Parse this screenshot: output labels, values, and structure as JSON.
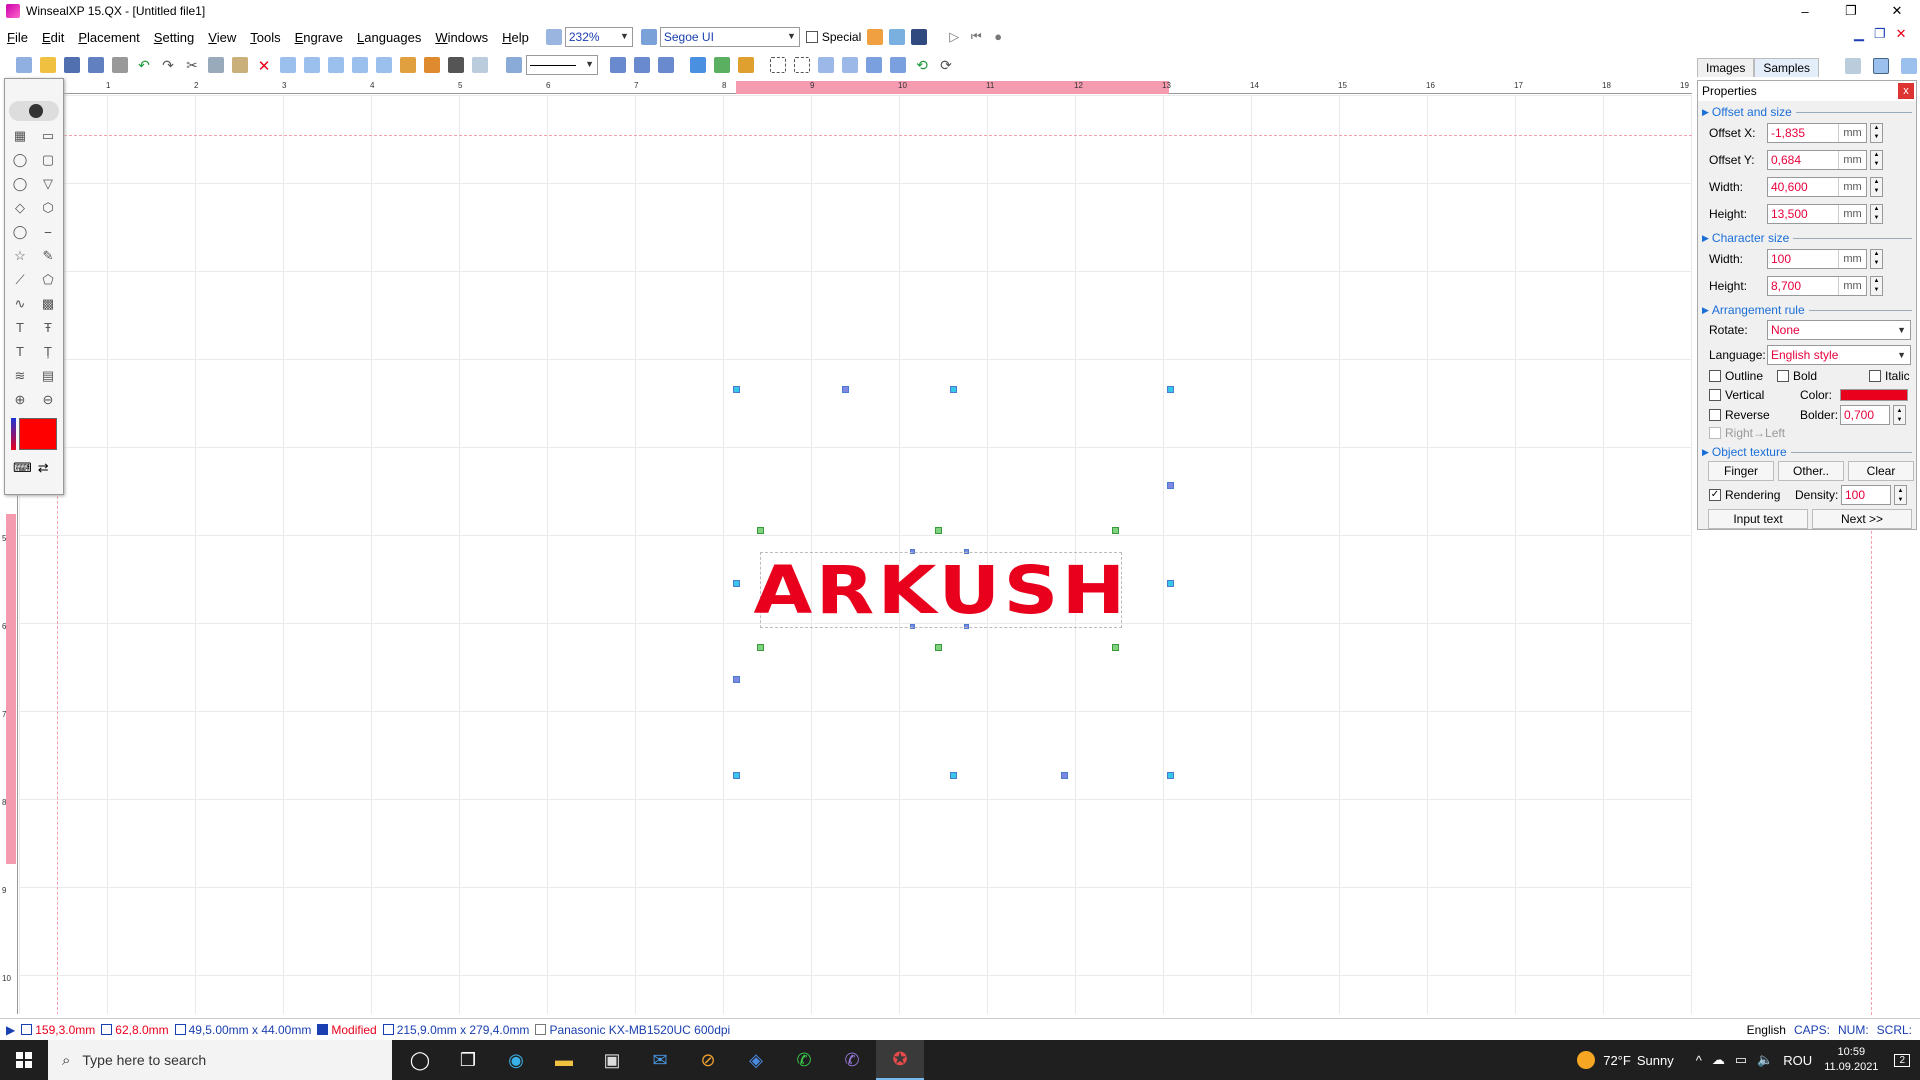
{
  "window": {
    "title": "WinsealXP 15.QX - [Untitled file1]",
    "min": "–",
    "max": "❐",
    "close": "✕"
  },
  "menu": [
    "File",
    "Edit",
    "Placement",
    "Setting",
    "View",
    "Tools",
    "Engrave",
    "Languages",
    "Windows",
    "Help"
  ],
  "toolbar": {
    "zoom": "232%",
    "font": "Segoe UI",
    "special_label": "Special"
  },
  "right_tabs": [
    "Images",
    "Samples"
  ],
  "ruler_h_labels": [
    "1",
    "2",
    "3",
    "4",
    "5",
    "6",
    "7",
    "8",
    "9",
    "10",
    "11",
    "12",
    "13",
    "14",
    "15",
    "16",
    "17",
    "18",
    "19"
  ],
  "ruler_v_labels": [
    "5",
    "6",
    "7",
    "8",
    "9",
    "10"
  ],
  "canvas_text": "ARKUSH",
  "properties": {
    "title": "Properties",
    "close": "x",
    "sec_offset": "Offset and size",
    "offset_x_label": "Offset X:",
    "offset_x": "-1,835",
    "offset_y_label": "Offset Y:",
    "offset_y": "0,684",
    "width_label": "Width:",
    "width": "40,600",
    "height_label": "Height:",
    "height": "13,500",
    "unit": "mm",
    "sec_char": "Character size",
    "char_width_label": "Width:",
    "char_width": "100",
    "char_height_label": "Height:",
    "char_height": "8,700",
    "sec_arrange": "Arrangement rule",
    "rotate_label": "Rotate:",
    "rotate": "None",
    "language_label": "Language:",
    "language": "English style",
    "outline": "Outline",
    "bold": "Bold",
    "italic": "Italic",
    "vertical": "Vertical",
    "color_label": "Color:",
    "reverse": "Reverse",
    "bolder_label": "Bolder:",
    "bolder": "0,700",
    "right_left": "Right→Left",
    "sec_texture": "Object texture",
    "finger": "Finger",
    "other": "Other..",
    "clear": "Clear",
    "rendering": "Rendering",
    "density_label": "Density:",
    "density": "100",
    "input_text": "Input text",
    "next": "Next >>"
  },
  "status": {
    "pos_x": "159,3.0mm",
    "pos_y": "62,8.0mm",
    "size": "49,5.00mm x 44.00mm",
    "modified": "Modified",
    "paper": "215,9.0mm x 279,4.0mm",
    "printer": "Panasonic KX-MB1520UC 600dpi",
    "lang": "English",
    "caps": "CAPS:",
    "num": "NUM:",
    "scrl": "SCRL:"
  },
  "taskbar": {
    "search_placeholder": "Type here to search",
    "temp": "72°F",
    "weather": "Sunny",
    "lang": "ROU",
    "time": "10:59",
    "date": "11.09.2021",
    "notif": "2"
  },
  "colors": {
    "accent_red": "#e8001c",
    "ruler_highlight": "#f49bb0",
    "section_blue": "#1a6ed8"
  }
}
